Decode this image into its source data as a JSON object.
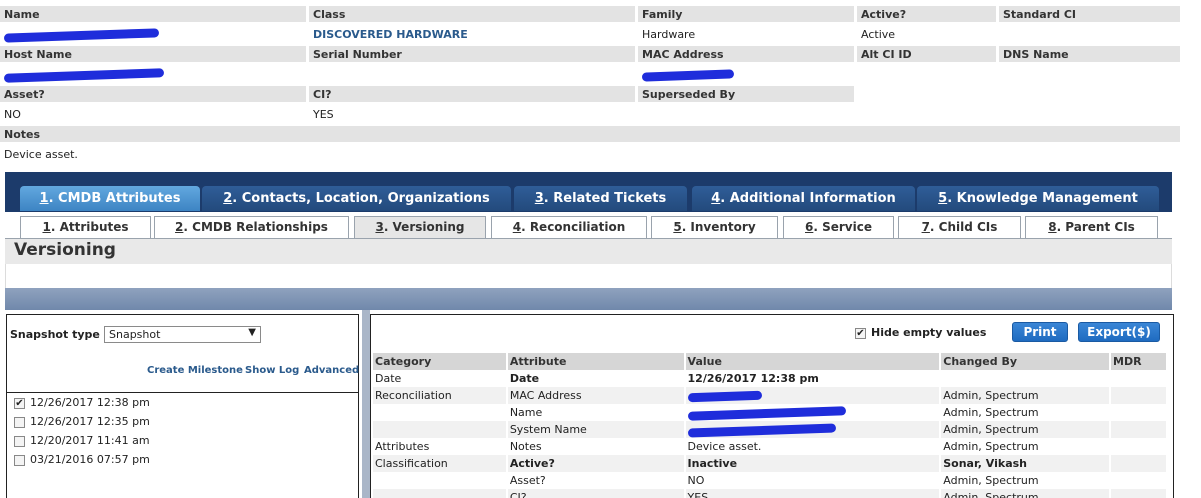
{
  "ci": {
    "labels": {
      "name": "Name",
      "class": "Class",
      "family": "Family",
      "active": "Active?",
      "standard_ci": "Standard CI",
      "host_name": "Host Name",
      "serial_number": "Serial Number",
      "mac_address": "MAC Address",
      "alt_ci_id": "Alt CI ID",
      "dns_name": "DNS Name",
      "asset": "Asset?",
      "ci": "CI?",
      "superseded_by": "Superseded By",
      "notes": "Notes"
    },
    "values": {
      "class": "DISCOVERED HARDWARE",
      "family": "Hardware",
      "active": "Active",
      "asset": "NO",
      "ci": "YES",
      "notes": "Device asset."
    }
  },
  "main_tabs": [
    {
      "num": "1",
      "label": ". CMDB Attributes",
      "active": true
    },
    {
      "num": "2",
      "label": ". Contacts, Location, Organizations",
      "active": false
    },
    {
      "num": "3",
      "label": ". Related Tickets",
      "active": false
    },
    {
      "num": "4",
      "label": ". Additional Information",
      "active": false
    },
    {
      "num": "5",
      "label": ". Knowledge Management",
      "active": false
    }
  ],
  "sub_tabs": [
    {
      "num": "1",
      "label": ". Attributes"
    },
    {
      "num": "2",
      "label": ". CMDB Relationships"
    },
    {
      "num": "3",
      "label": ". Versioning",
      "active": true
    },
    {
      "num": "4",
      "label": ". Reconciliation"
    },
    {
      "num": "5",
      "label": ". Inventory"
    },
    {
      "num": "6",
      "label": ". Service"
    },
    {
      "num": "7",
      "label": ". Child CIs"
    },
    {
      "num": "8",
      "label": ". Parent CIs"
    }
  ],
  "section_title": "Versioning",
  "left": {
    "snapshot_type_label": "Snapshot type",
    "snapshot_type_value": "Snapshot",
    "links": [
      "Create Milestone",
      "Show Log",
      "Advanced"
    ],
    "snapshots": [
      {
        "date": "12/26/2017 12:38 pm",
        "checked": true
      },
      {
        "date": "12/26/2017 12:35 pm",
        "checked": false
      },
      {
        "date": "12/20/2017 11:41 am",
        "checked": false
      },
      {
        "date": "03/21/2016 07:57 pm",
        "checked": false
      }
    ]
  },
  "right": {
    "hide_empty_label": "Hide empty values",
    "hide_empty_checked": true,
    "print_label": "Print",
    "export_label": "Export($)",
    "columns": [
      "Category",
      "Attribute",
      "Value",
      "Changed By",
      "MDR"
    ],
    "rows": [
      {
        "category": "Date",
        "attribute": "Date",
        "value": "12/26/2017 12:38 pm",
        "changed_by": "",
        "mdr": "",
        "bold": true
      },
      {
        "category": "Reconciliation",
        "attribute": "MAC Address",
        "value": "",
        "changed_by": "Admin, Spectrum",
        "mdr": ""
      },
      {
        "category": "",
        "attribute": "Name",
        "value": "",
        "changed_by": "Admin, Spectrum",
        "mdr": ""
      },
      {
        "category": "",
        "attribute": "System Name",
        "value": "",
        "changed_by": "Admin, Spectrum",
        "mdr": ""
      },
      {
        "category": "Attributes",
        "attribute": "Notes",
        "value": "Device asset.",
        "changed_by": "Admin, Spectrum",
        "mdr": ""
      },
      {
        "category": "Classification",
        "attribute": "Active?",
        "value": "Inactive",
        "changed_by": "Sonar, Vikash",
        "mdr": "",
        "bold": true
      },
      {
        "category": "",
        "attribute": "Asset?",
        "value": "NO",
        "changed_by": "Admin, Spectrum",
        "mdr": ""
      },
      {
        "category": "",
        "attribute": "CI?",
        "value": "YES",
        "changed_by": "Admin, Spectrum",
        "mdr": ""
      }
    ]
  }
}
